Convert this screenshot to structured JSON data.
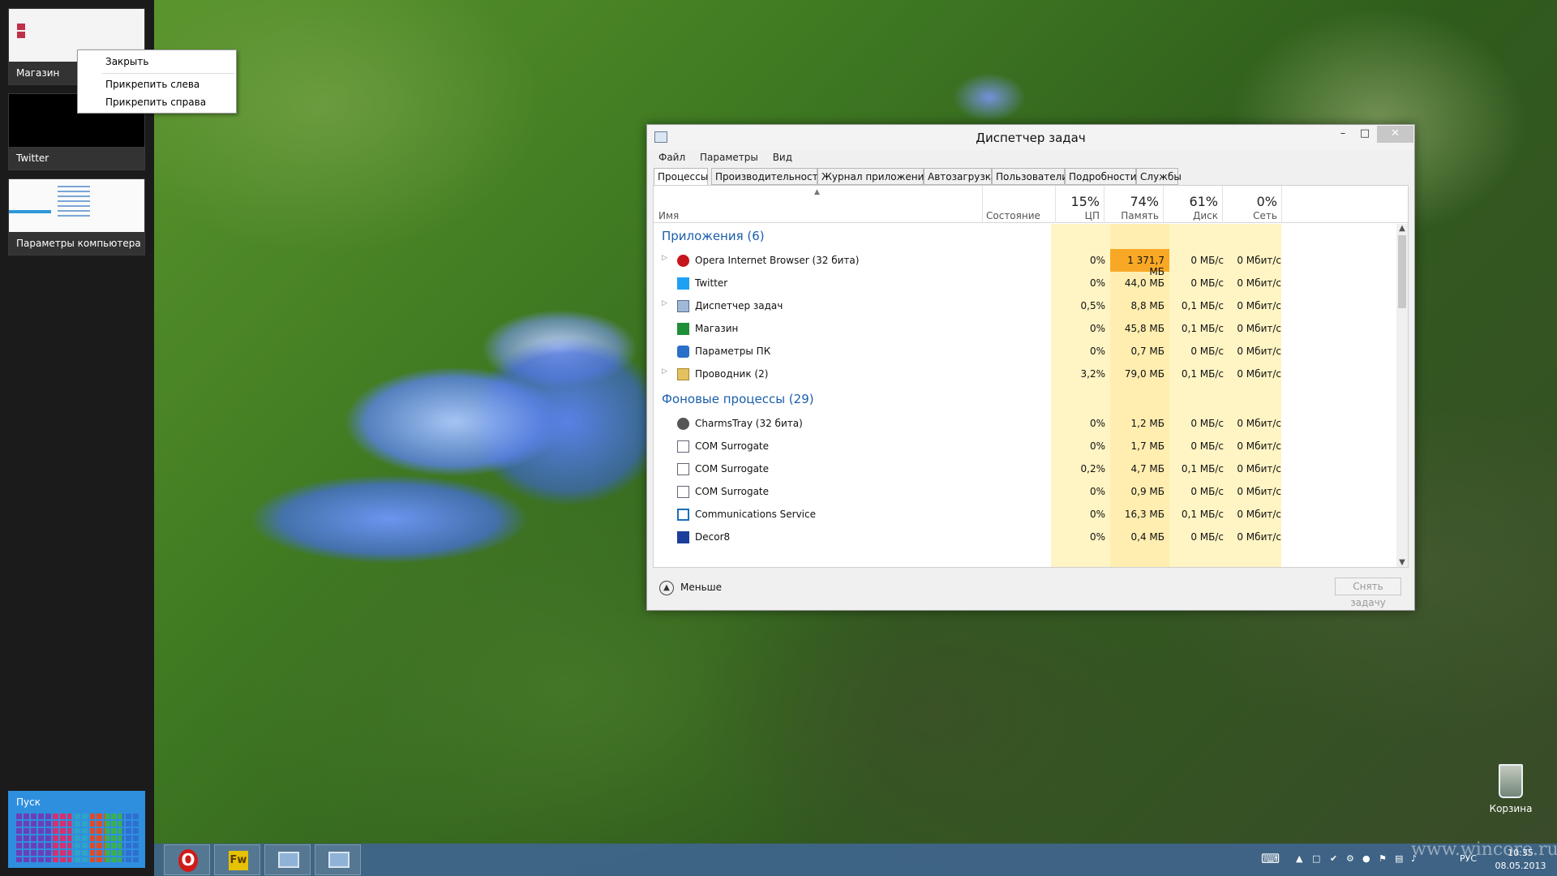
{
  "switcher": {
    "thumbs": [
      {
        "label": "Магазин"
      },
      {
        "label": "Twitter"
      },
      {
        "label": "Параметры компьютера"
      }
    ],
    "start_label": "Пуск"
  },
  "context_menu": {
    "items": [
      "Закрыть",
      "Прикрепить слева",
      "Прикрепить справа"
    ]
  },
  "task_manager": {
    "title": "Диспетчер задач",
    "menu": [
      "Файл",
      "Параметры",
      "Вид"
    ],
    "tabs": [
      "Процессы",
      "Производительность",
      "Журнал приложений",
      "Автозагрузка",
      "Пользователи",
      "Подробности",
      "Службы"
    ],
    "active_tab": "Процессы",
    "columns": {
      "name": "Имя",
      "state": "Состояние",
      "cpu": {
        "pct": "15%",
        "label": "ЦП"
      },
      "mem": {
        "pct": "74%",
        "label": "Память"
      },
      "disk": {
        "pct": "61%",
        "label": "Диск"
      },
      "net": {
        "pct": "0%",
        "label": "Сеть"
      }
    },
    "groups": [
      {
        "title": "Приложения (6)",
        "rows": [
          {
            "name": "Opera Internet Browser (32 бита)",
            "cpu": "0%",
            "mem": "1 371,7 МБ",
            "disk": "0 МБ/с",
            "net": "0 Мбит/с",
            "expandable": true,
            "icon": "opera-icon",
            "hot": true
          },
          {
            "name": "Twitter",
            "cpu": "0%",
            "mem": "44,0 МБ",
            "disk": "0 МБ/с",
            "net": "0 Мбит/с",
            "expandable": false,
            "icon": "twitter-icon"
          },
          {
            "name": "Диспетчер задач",
            "cpu": "0,5%",
            "mem": "8,8 МБ",
            "disk": "0,1 МБ/с",
            "net": "0 Мбит/с",
            "expandable": true,
            "icon": "task-manager-icon"
          },
          {
            "name": "Магазин",
            "cpu": "0%",
            "mem": "45,8 МБ",
            "disk": "0,1 МБ/с",
            "net": "0 Мбит/с",
            "expandable": false,
            "icon": "store-icon"
          },
          {
            "name": "Параметры ПК",
            "cpu": "0%",
            "mem": "0,7 МБ",
            "disk": "0 МБ/с",
            "net": "0 Мбит/с",
            "expandable": false,
            "icon": "settings-icon"
          },
          {
            "name": "Проводник (2)",
            "cpu": "3,2%",
            "mem": "79,0 МБ",
            "disk": "0,1 МБ/с",
            "net": "0 Мбит/с",
            "expandable": true,
            "icon": "explorer-icon"
          }
        ]
      },
      {
        "title": "Фоновые процессы (29)",
        "rows": [
          {
            "name": "CharmsTray (32 бита)",
            "cpu": "0%",
            "mem": "1,2 МБ",
            "disk": "0 МБ/с",
            "net": "0 Мбит/с",
            "expandable": false,
            "icon": "gear-icon"
          },
          {
            "name": "COM Surrogate",
            "cpu": "0%",
            "mem": "1,7 МБ",
            "disk": "0 МБ/с",
            "net": "0 Мбит/с",
            "expandable": false,
            "icon": "process-icon"
          },
          {
            "name": "COM Surrogate",
            "cpu": "0,2%",
            "mem": "4,7 МБ",
            "disk": "0,1 МБ/с",
            "net": "0 Мбит/с",
            "expandable": false,
            "icon": "process-icon"
          },
          {
            "name": "COM Surrogate",
            "cpu": "0%",
            "mem": "0,9 МБ",
            "disk": "0 МБ/с",
            "net": "0 Мбит/с",
            "expandable": false,
            "icon": "process-icon"
          },
          {
            "name": "Communications Service",
            "cpu": "0%",
            "mem": "16,3 МБ",
            "disk": "0,1 МБ/с",
            "net": "0 Мбит/с",
            "expandable": false,
            "icon": "mail-icon"
          },
          {
            "name": "Decor8",
            "cpu": "0%",
            "mem": "0,4 МБ",
            "disk": "0 МБ/с",
            "net": "0 Мбит/с",
            "expandable": false,
            "icon": "decor-icon"
          }
        ]
      }
    ],
    "footer": {
      "less_label": "Меньше",
      "end_task_label": "Снять задачу"
    }
  },
  "desktop": {
    "recycle_label": "Корзина",
    "watermark": "www.wincore.ru"
  },
  "taskbar": {
    "apps": [
      "opera",
      "fireworks",
      "settings",
      "task-manager"
    ],
    "fw_label": "Fw",
    "lang": "РУС",
    "time": "10:35",
    "date": "08.05.2013"
  },
  "colors": {
    "mem_hot": "#f9a825",
    "group_title": "#1b5faa",
    "start_tile": "#2f8fdf"
  }
}
